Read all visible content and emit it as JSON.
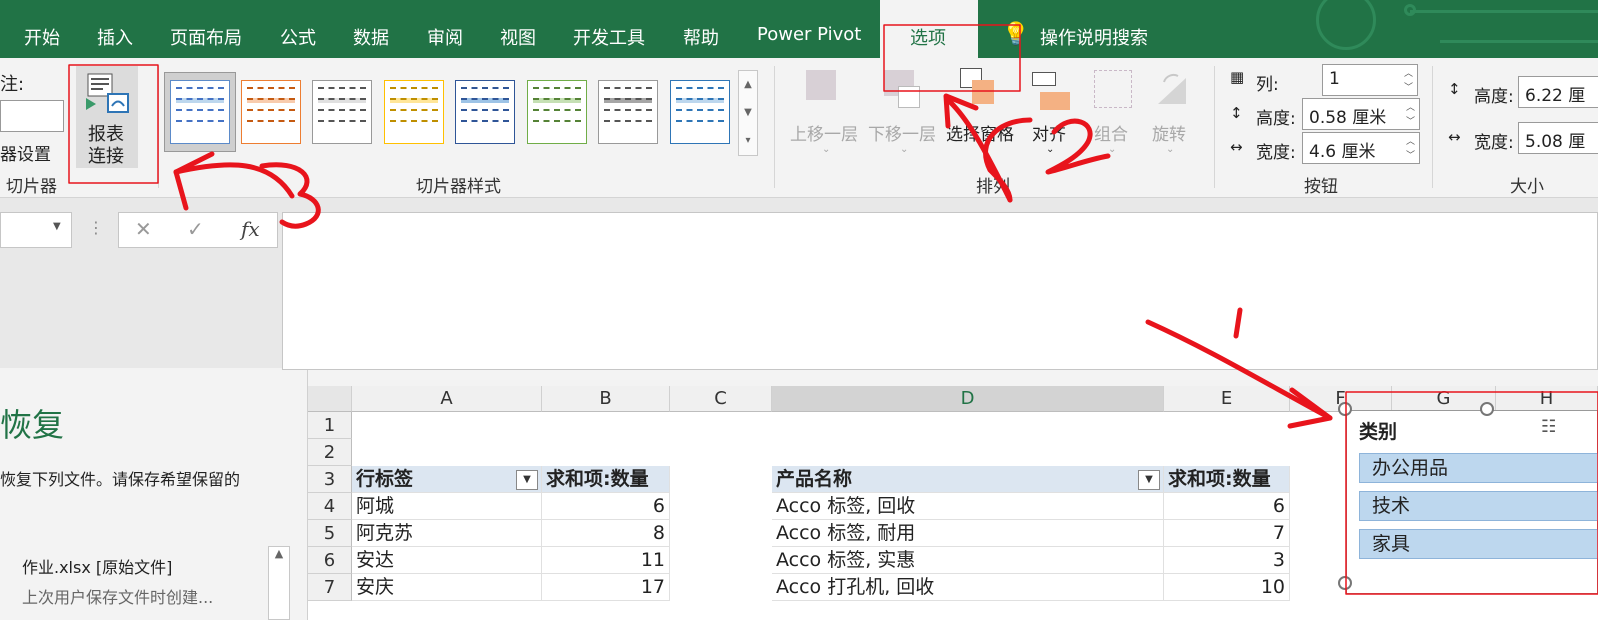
{
  "ribbon_tabs": [
    "开始",
    "插入",
    "页面布局",
    "公式",
    "数据",
    "审阅",
    "视图",
    "开发工具",
    "帮助",
    "Power Pivot",
    "选项"
  ],
  "search_tab": "操作说明搜索",
  "slicer_group": {
    "caption_label": "注:",
    "settings_label": "器设置",
    "report_conn_line1": "报表",
    "report_conn_line2": "连接",
    "group_label": "切片器"
  },
  "slicer_styles_label": "切片器样式",
  "arrange": {
    "bring_forward": "上移一层",
    "send_backward": "下移一层",
    "selection_pane": "选择窗格",
    "align": "对齐",
    "group": "组合",
    "rotate": "旋转",
    "group_label": "排列"
  },
  "buttons_group": {
    "columns_label": "列:",
    "columns_value": "1",
    "height_label": "高度:",
    "height_value": "0.58 厘米",
    "width_label": "宽度:",
    "width_value": "4.6 厘米",
    "group_label": "按钮"
  },
  "size_group": {
    "height_label": "高度:",
    "height_value": "6.22 厘",
    "width_label": "宽度:",
    "width_value": "5.08 厘",
    "group_label": "大小"
  },
  "formula_bar": {
    "fx": "fx",
    "cancel": "✕",
    "enter": "✓"
  },
  "recovery": {
    "title": "恢复",
    "message": "恢复下列文件。请保存希望保留的",
    "file_name": "作业.xlsx  [原始文件]",
    "file_desc": "上次用户保存文件时创建..."
  },
  "grid": {
    "columns": [
      "A",
      "B",
      "C",
      "D",
      "E",
      "F",
      "G",
      "H"
    ],
    "rows": [
      "1",
      "2",
      "3",
      "4",
      "5",
      "6",
      "7"
    ],
    "pivot1_header": [
      "行标签",
      "求和项:数量"
    ],
    "pivot1_rows": [
      [
        "阿城",
        "6"
      ],
      [
        "阿克苏",
        "8"
      ],
      [
        "安达",
        "11"
      ],
      [
        "安庆",
        "17"
      ]
    ],
    "pivot2_header": [
      "产品名称",
      "求和项:数量"
    ],
    "pivot2_rows": [
      [
        "Acco 标签, 回收",
        "6"
      ],
      [
        "Acco 标签, 耐用",
        "7"
      ],
      [
        "Acco 标签, 实惠",
        "3"
      ],
      [
        "Acco 打孔机, 回收",
        "10"
      ]
    ]
  },
  "slicer": {
    "title": "类别",
    "items": [
      "办公用品",
      "技术",
      "家具"
    ]
  },
  "annotations": [
    "1",
    "2",
    "3"
  ],
  "colors": {
    "excel_green": "#217346",
    "slicer_item": "#bdd7ee",
    "pivot_header": "#dce6f1",
    "annotation_red": "#e8141c"
  }
}
